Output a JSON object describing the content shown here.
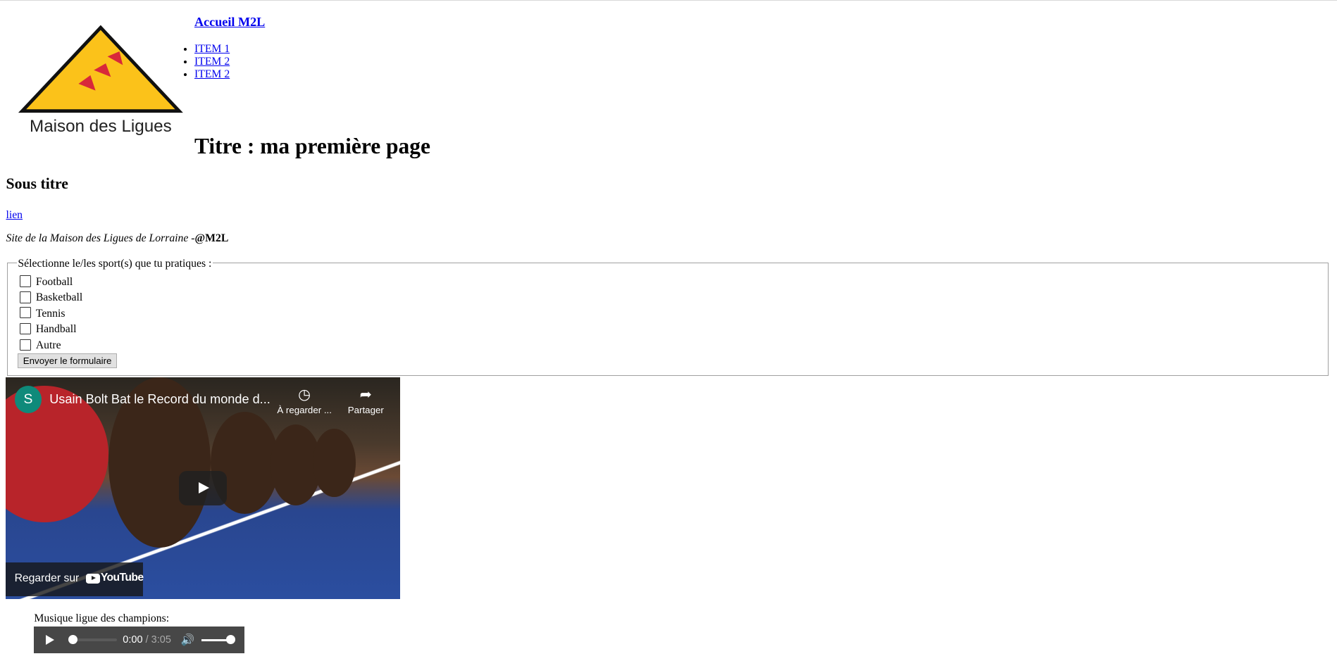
{
  "logo": {
    "text": "Maison des Ligues",
    "colors": {
      "triangle": "#fbc21a",
      "border": "#111111"
    }
  },
  "nav": {
    "home": "Accueil M2L",
    "items": [
      "ITEM 1",
      "ITEM 2",
      "ITEM 2"
    ]
  },
  "title": "Titre : ma première page",
  "subtitle": "Sous titre",
  "link": "lien",
  "footer": {
    "text": "Site de la Maison des Ligues de Lorraine -",
    "handle": "@M2L"
  },
  "form": {
    "legend": "Sélectionne le/les sport(s) que tu pratiques :",
    "options": [
      "Football",
      "Basketball",
      "Tennis",
      "Handball",
      "Autre"
    ],
    "submit": "Envoyer le formulaire"
  },
  "video": {
    "channel_initial": "S",
    "title": "Usain Bolt Bat le Record du monde d...",
    "watch_later": "À regarder ...",
    "share": "Partager",
    "watch_on": "Regarder sur",
    "youtube": "YouTube"
  },
  "audio": {
    "label": "Musique ligue des champions:",
    "current": "0:00",
    "duration": "/ 3:05",
    "progress": 0,
    "volume": 1.0
  }
}
